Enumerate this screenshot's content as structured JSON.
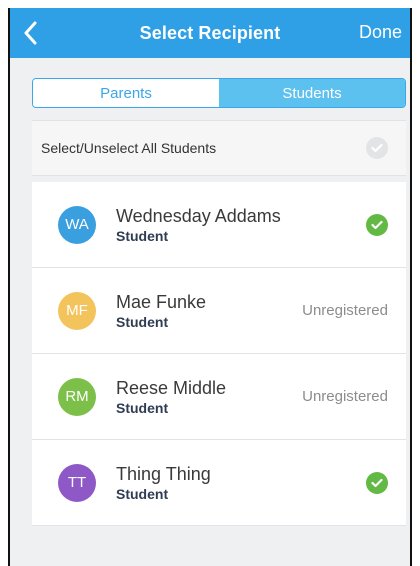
{
  "header": {
    "title": "Select Recipient",
    "done_label": "Done",
    "color": "#2f9fe6"
  },
  "segment": {
    "parents_label": "Parents",
    "students_label": "Students",
    "selected": "Students"
  },
  "select_all": {
    "label": "Select/Unselect All Students",
    "checked": false
  },
  "recipients": [
    {
      "initials": "WA",
      "name": "Wednesday Addams",
      "role": "Student",
      "avatar_color": "#3a9fde",
      "status": "checked",
      "status_text": ""
    },
    {
      "initials": "MF",
      "name": "Mae Funke",
      "role": "Student",
      "avatar_color": "#f3c35c",
      "status": "unregistered",
      "status_text": "Unregistered"
    },
    {
      "initials": "RM",
      "name": "Reese Middle",
      "role": "Student",
      "avatar_color": "#7cc04a",
      "status": "unregistered",
      "status_text": "Unregistered"
    },
    {
      "initials": "TT",
      "name": "Thing Thing",
      "role": "Student",
      "avatar_color": "#8e59c7",
      "status": "checked",
      "status_text": ""
    }
  ],
  "icons": {
    "back": "chevron-left-icon",
    "check": "check-circle-icon"
  }
}
